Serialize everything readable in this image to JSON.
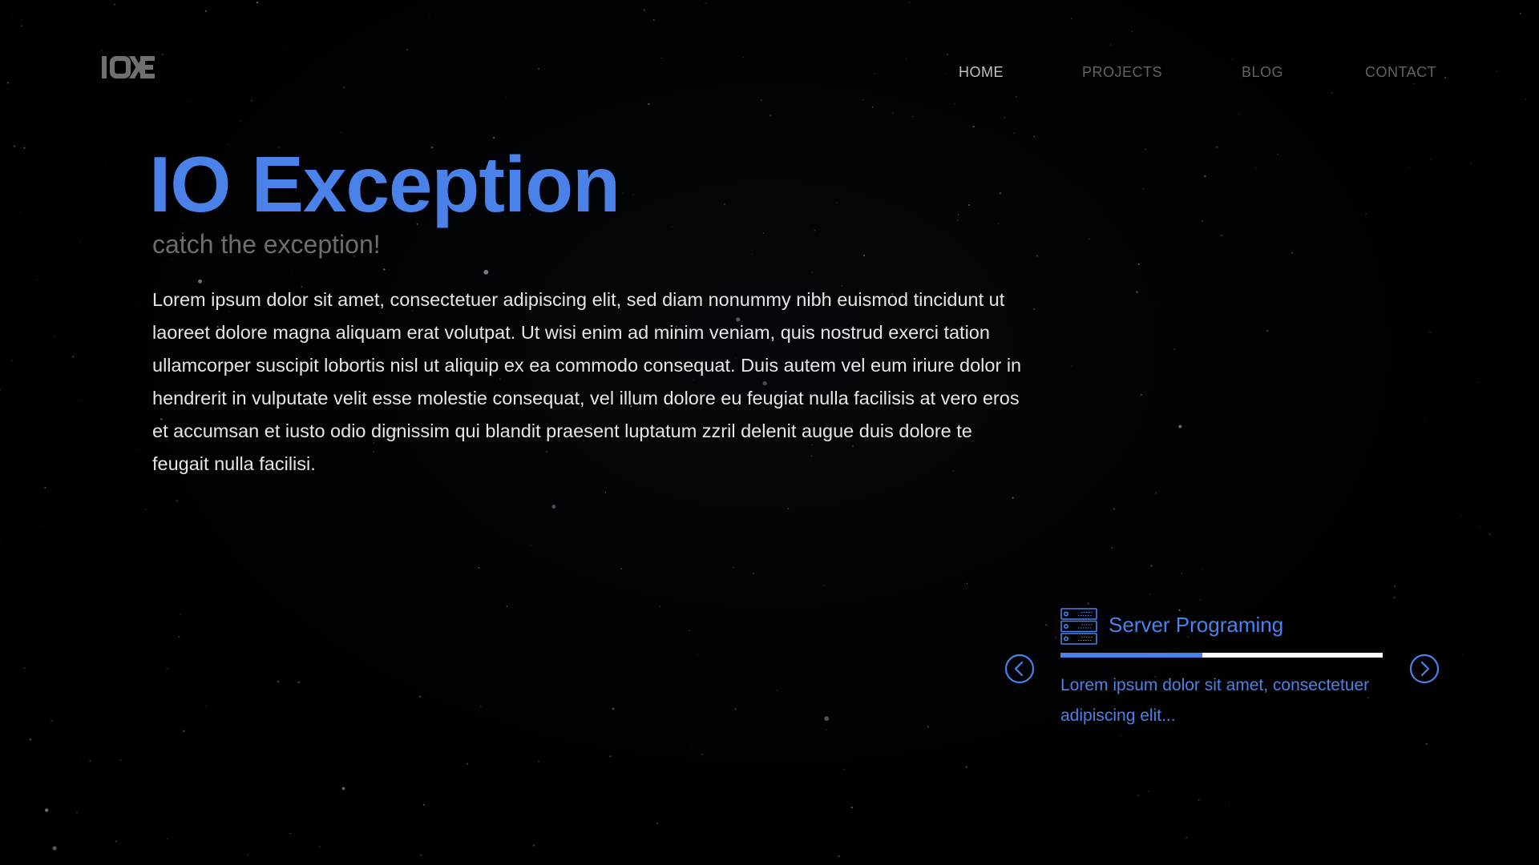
{
  "brand": {
    "logo_text": "IOXE"
  },
  "nav": {
    "items": [
      {
        "label": "HOME",
        "active": true
      },
      {
        "label": "PROJECTS",
        "active": false
      },
      {
        "label": "BLOG",
        "active": false
      },
      {
        "label": "CONTACT",
        "active": false
      }
    ]
  },
  "hero": {
    "title": "IO Exception",
    "tagline": "catch the exception!",
    "body": "Lorem ipsum dolor sit amet, consectetuer adipiscing elit, sed diam nonummy nibh euismod tincidunt ut laoreet dolore magna aliquam erat volutpat. Ut wisi enim ad minim veniam, quis nostrud exerci tation ullamcorper suscipit lobortis nisl ut aliquip ex ea commodo consequat. Duis autem vel eum iriure dolor in hendrerit in vulputate velit esse molestie consequat, vel illum dolore eu feugiat nulla facilisis at vero eros et accumsan et iusto odio dignissim qui blandit praesent luptatum zzril delenit augue duis dolore te feugait nulla facilisi."
  },
  "carousel": {
    "card": {
      "icon": "server-icon",
      "title": "Server Programing",
      "description": "Lorem ipsum dolor sit amet, consectetuer adipiscing elit...",
      "progress": 0.44
    },
    "prev_icon": "chevron-left-icon",
    "next_icon": "chevron-right-icon"
  },
  "colors": {
    "background": "#000000",
    "accent": "#4b82e9",
    "nav_active": "#bfc2c7",
    "nav_inactive": "#5f6267",
    "tagline": "#6a6d72",
    "body_text": "#e6e6e6",
    "progress_track": "#ffffff"
  }
}
